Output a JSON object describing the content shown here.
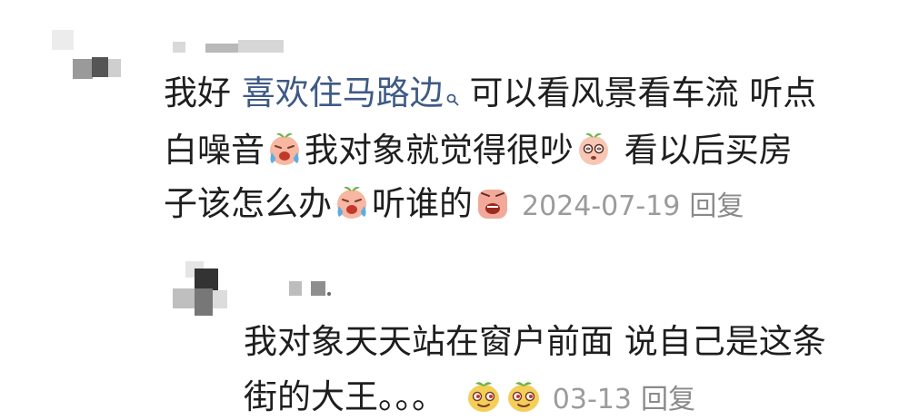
{
  "comment": {
    "author": "",
    "link_text": "喜欢住马路边",
    "text_before_link": "我好 ",
    "line1_after": " 可以看风景看车流 听点",
    "line2_part1": "白噪音",
    "line2_part2": "我对象就觉得很吵",
    "line2_part3": " 看以后买房",
    "line3_part1": "子该怎么办",
    "line3_part2": "听谁的",
    "date": "2024-07-19",
    "reply_label": "回复",
    "emojis": [
      "crying-emoji",
      "dizzy-eyes-emoji",
      "crying-emoji",
      "anguished-emoji"
    ]
  },
  "reply_comment": {
    "author": "",
    "line1": "我对象天天站在窗户前面 说自己是这条",
    "line2": "街的大王。。。",
    "date": "03-13",
    "reply_label": "回复",
    "emojis": [
      "sly-grin-emoji",
      "sly-grin-emoji"
    ]
  },
  "colors": {
    "link": "#3e5a86",
    "text": "#1e1e1e",
    "meta": "#9b9b9b"
  }
}
